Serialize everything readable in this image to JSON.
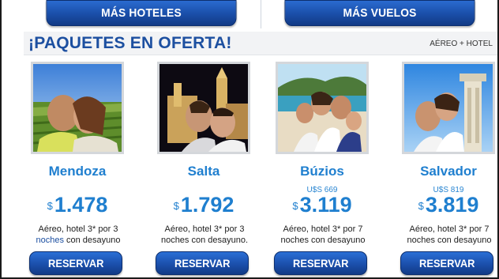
{
  "top_buttons": {
    "hoteles": "MÁS HOTELES",
    "vuelos": "MÁS VUELOS"
  },
  "section": {
    "title_part1": "¡PAQUETES EN ",
    "title_part2": "OFERTA!",
    "tag": "AÉREO + HOTEL"
  },
  "colors": {
    "brand_blue": "#1c4fa0",
    "accent_blue": "#1f7fcf",
    "button_blue": "#1b4fab"
  },
  "cards": [
    {
      "city": "Mendoza",
      "usd": "",
      "currency": "$",
      "price": "1.478",
      "desc_a": "Aéreo, hotel 3* por 3",
      "desc_b_hl": "noches",
      "desc_b": " con desayuno",
      "button": "RESERVAR",
      "photo_icon": "couple-vineyard-photo"
    },
    {
      "city": "Salta",
      "usd": "",
      "currency": "$",
      "price": "1.792",
      "desc_a": "Aéreo, hotel 3* por 3",
      "desc_b_hl": "",
      "desc_b": "noches con desayuno.",
      "button": "RESERVAR",
      "photo_icon": "couple-cathedral-photo"
    },
    {
      "city": "Búzios",
      "usd": "U$S 669",
      "currency": "$",
      "price": "3.119",
      "desc_a": "Aéreo, hotel 3* por 7",
      "desc_b_hl": "",
      "desc_b": "noches con desayuno",
      "button": "RESERVAR",
      "photo_icon": "family-beach-photo"
    },
    {
      "city": "Salvador",
      "usd": "U$S 819",
      "currency": "$",
      "price": "3.819",
      "desc_a": "Aéreo, hotel 3* por 7",
      "desc_b_hl": "",
      "desc_b": "noches con desayuno",
      "button": "RESERVAR",
      "photo_icon": "couple-elevator-photo"
    }
  ]
}
